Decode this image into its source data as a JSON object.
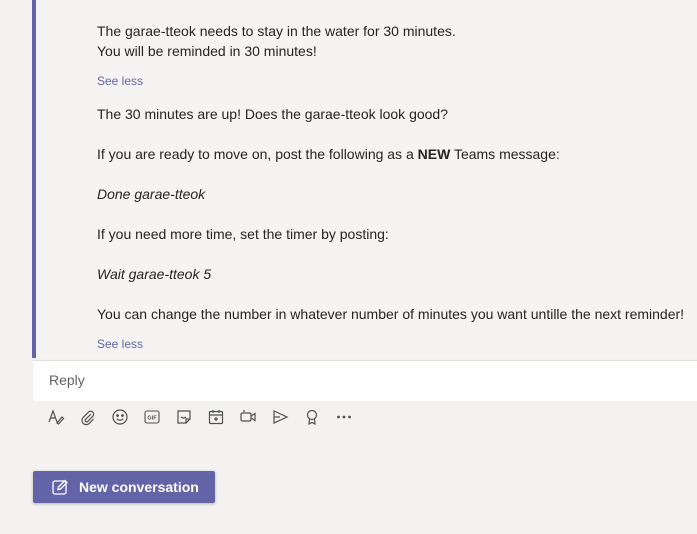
{
  "message1": {
    "line1": "The garae-tteok needs to stay in the water for 30 minutes.",
    "line2": "You will be reminded in 30 minutes!",
    "see_less": "See less"
  },
  "message2": {
    "line1": "The 30 minutes are up! Does the garae-tteok look good?",
    "line2_pre": "If you are ready to move on, post the following as a ",
    "line2_bold": "NEW",
    "line2_post": " Teams message:",
    "cmd_done": "Done garae-tteok",
    "line3": "If you need more time, set the timer by posting:",
    "cmd_wait": "Wait garae-tteok 5",
    "line4": "You can change the number in whatever number of minutes you want untille the next reminder!",
    "see_less": "See less"
  },
  "reply": {
    "placeholder": "Reply"
  },
  "toolbar": {
    "icons": [
      "format-icon",
      "attach-icon",
      "emoji-icon",
      "gif-icon",
      "sticker-icon",
      "schedule-meeting-icon",
      "meet-now-icon",
      "stream-icon",
      "praise-icon",
      "more-options-icon"
    ]
  },
  "new_conversation": {
    "label": "New conversation"
  },
  "colors": {
    "accent": "#6264a7",
    "background": "#f3f2f1",
    "text": "#252423"
  }
}
